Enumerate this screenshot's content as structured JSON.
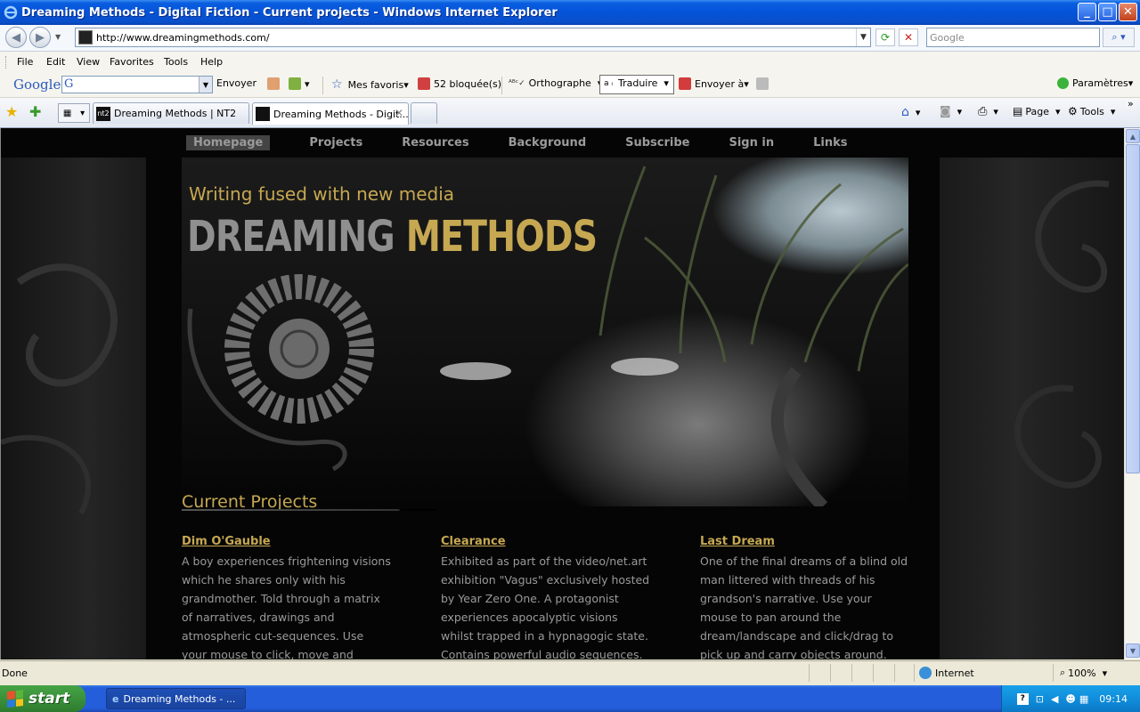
{
  "window": {
    "title": "Dreaming Methods - Digital Fiction - Current projects - Windows Internet Explorer",
    "minimize": "_",
    "maximize": "□",
    "close": "✕"
  },
  "address": {
    "url": "http://www.dreamingmethods.com/",
    "search_placeholder": "Google"
  },
  "menu": [
    "File",
    "Edit",
    "View",
    "Favorites",
    "Tools",
    "Help"
  ],
  "google_toolbar": {
    "logo": "Google",
    "envoyer": "Envoyer",
    "favoris": "Mes favoris",
    "blocked": "52 bloquée(s)",
    "orthographe": "Orthographe",
    "traduire": "Traduire",
    "envoyer_a": "Envoyer à",
    "parametres": "Paramètres"
  },
  "tabs": [
    {
      "label": "Dreaming Methods | NT2",
      "icon": "nt2"
    },
    {
      "label": "Dreaming Methods - Digit...",
      "active": true
    }
  ],
  "commands": {
    "page": "Page",
    "tools": "Tools"
  },
  "site": {
    "nav": [
      "Homepage",
      "Projects",
      "Resources",
      "Background",
      "Subscribe",
      "Sign in",
      "Links"
    ],
    "tagline": "Writing fused with new media",
    "brand_a": "DREAMING",
    "brand_b": "METHODS",
    "section_title": "Current Projects",
    "projects": [
      {
        "title": "Dim O'Gauble",
        "desc": "A boy experiences frightening visions which he shares only with his grandmother. Told through a matrix of narratives, drawings and atmospheric cut-sequences. Use your mouse to click, move and explore."
      },
      {
        "title": "Clearance",
        "desc": "Exhibited as part of the video/net.art exhibition \"Vagus\" exclusively hosted by Year Zero One. A protagonist experiences apocalyptic visions whilst trapped in a hypnagogic state. Contains powerful audio sequences."
      },
      {
        "title": "Last Dream",
        "desc": "One of the final dreams of a blind old man littered with threads of his grandson's narrative. Use your mouse to pan around the dream/landscape and click/drag to pick up and carry objects around."
      }
    ]
  },
  "status": {
    "text": "Done",
    "zone": "Internet",
    "zoom": "100%"
  },
  "taskbar": {
    "start": "start",
    "item": "Dreaming Methods - ...",
    "time": "09:14"
  },
  "colors": {
    "gold": "#c6a852",
    "nav_grey": "#9b9b9b",
    "xp_blue": "#245edb"
  }
}
